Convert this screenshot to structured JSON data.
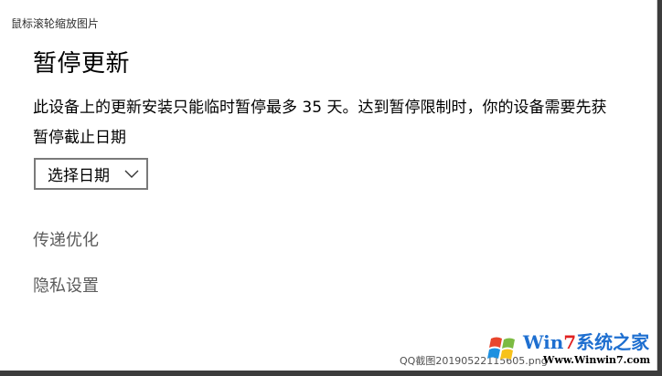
{
  "window": {
    "title": "鼠标滚轮缩放图片"
  },
  "settings": {
    "page_title": "暂停更新",
    "description": "此设备上的更新安装只能临时暂停最多 35 天。达到暂停限制时，你的设备需要先获",
    "pause_until_label": "暂停截止日期",
    "date_select": {
      "selected": "选择日期",
      "icon": "chevron-down-icon"
    },
    "links": [
      {
        "label": "传递优化"
      },
      {
        "label": "隐私设置"
      }
    ]
  },
  "overlay": {
    "filename": "QQ截图20190522115605.png",
    "watermark": {
      "brand_prefix": "Win",
      "brand_number": "7",
      "brand_suffix": "系统之家",
      "url": "Www.Winwin7.com",
      "colors": {
        "blue": "#1e6fd0",
        "red": "#e02020"
      }
    }
  }
}
